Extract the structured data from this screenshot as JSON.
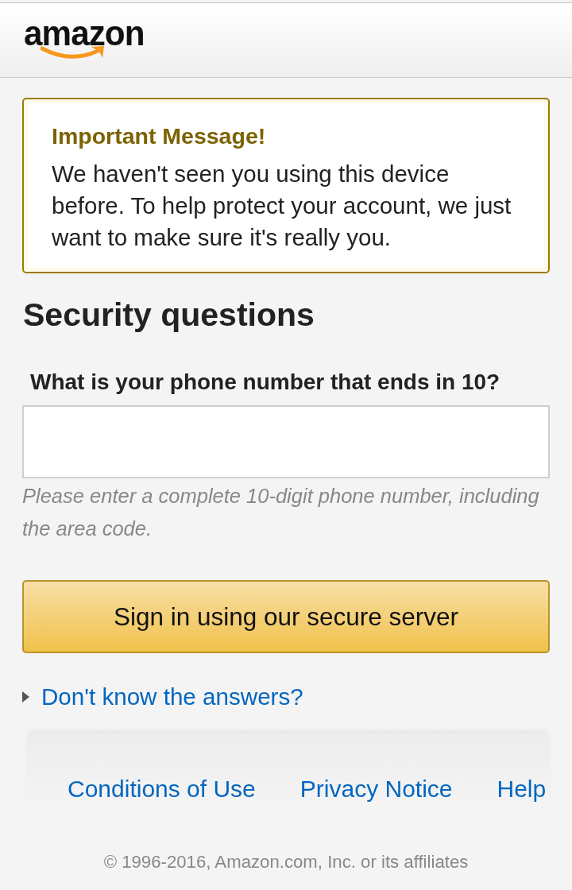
{
  "header": {
    "logo": "amazon"
  },
  "alert": {
    "title": "Important Message!",
    "message": "We haven't seen you using this device before. To help protect your account, we just want to make sure it's really you."
  },
  "heading": "Security questions",
  "question": {
    "label": "What is your phone number that ends in 10?",
    "hint": "Please enter a complete 10-digit phone number, including the area code."
  },
  "submit_button": "Sign in using our secure server",
  "help_link": {
    "label": "Don't know the answers?",
    "expanded": false
  },
  "footer": {
    "links": [
      "Conditions of Use",
      "Privacy Notice",
      "Help"
    ],
    "copyright": "© 1996-2016, Amazon.com, Inc. or its affiliates"
  }
}
